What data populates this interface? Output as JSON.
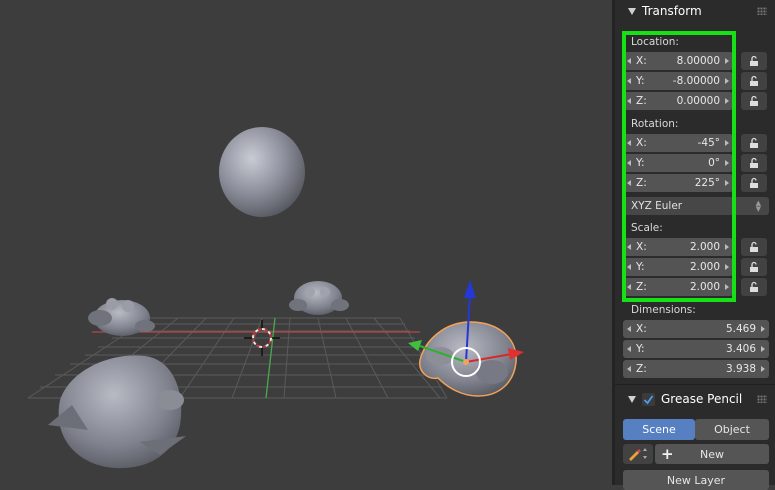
{
  "viewport": {
    "label": "3D Viewport"
  },
  "transform": {
    "title": "Transform",
    "location": {
      "label": "Location:",
      "x": {
        "axis": "X:",
        "value": "8.00000"
      },
      "y": {
        "axis": "Y:",
        "value": "-8.00000"
      },
      "z": {
        "axis": "Z:",
        "value": "0.00000"
      }
    },
    "rotation": {
      "label": "Rotation:",
      "x": {
        "axis": "X:",
        "value": "-45°"
      },
      "y": {
        "axis": "Y:",
        "value": "0°"
      },
      "z": {
        "axis": "Z:",
        "value": "225°"
      }
    },
    "rotation_mode": "XYZ Euler",
    "scale": {
      "label": "Scale:",
      "x": {
        "axis": "X:",
        "value": "2.000"
      },
      "y": {
        "axis": "Y:",
        "value": "2.000"
      },
      "z": {
        "axis": "Z:",
        "value": "2.000"
      }
    },
    "dimensions": {
      "label": "Dimensions:",
      "x": {
        "axis": "X:",
        "value": "5.469"
      },
      "y": {
        "axis": "Y:",
        "value": "3.406"
      },
      "z": {
        "axis": "Z:",
        "value": "3.938"
      }
    }
  },
  "grease_pencil": {
    "title": "Grease Pencil",
    "tabs": {
      "scene": "Scene",
      "object": "Object"
    },
    "new_label": "New",
    "new_layer_label": "New Layer"
  },
  "colors": {
    "highlight": "#16e016",
    "active_tab": "#5680c2",
    "selected_outline": "#f3a25a",
    "x_axis": "#e03030",
    "y_axis": "#40c040",
    "z_axis": "#2040e0"
  },
  "icons": [
    "triangle-down-icon",
    "lock-icon",
    "pencil-icon",
    "plus-icon",
    "checkmark-icon",
    "grip-icon",
    "3d-cursor-icon"
  ]
}
